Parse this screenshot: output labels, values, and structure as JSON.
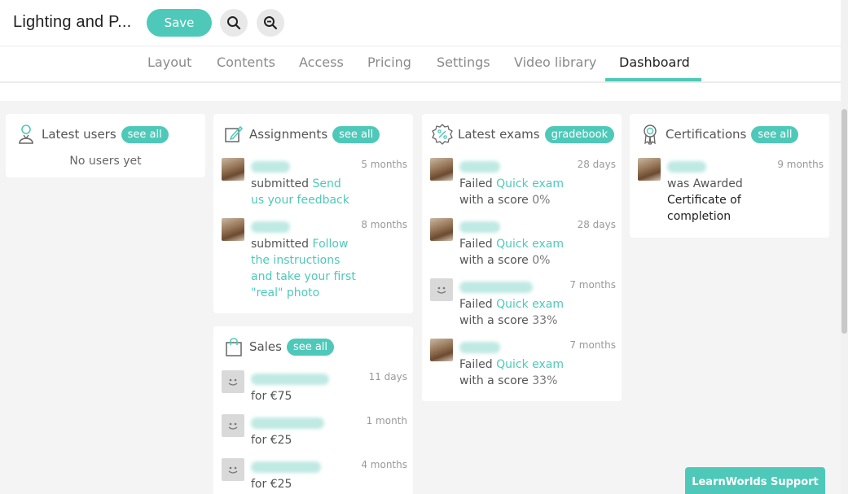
{
  "header": {
    "title": "Lighting and P...",
    "save_label": "Save"
  },
  "tabs": [
    {
      "label": "Layout"
    },
    {
      "label": "Contents"
    },
    {
      "label": "Access"
    },
    {
      "label": "Pricing"
    },
    {
      "label": "Settings"
    },
    {
      "label": "Video library"
    },
    {
      "label": "Dashboard",
      "active": true
    }
  ],
  "cards": {
    "users": {
      "title": "Latest users",
      "action": "see all",
      "empty": "No users yet"
    },
    "assignments": {
      "title": "Assignments",
      "action": "see all",
      "items": [
        {
          "time": "5 months",
          "verb": "submitted",
          "link": "Send us your feedback"
        },
        {
          "time": "8 months",
          "verb": "submitted",
          "link": "Follow the instructions and take your first \"real\" photo"
        }
      ]
    },
    "exams": {
      "title": "Latest exams",
      "action": "gradebook",
      "items": [
        {
          "time": "28 days",
          "verb": "Failed",
          "link": "Quick exam",
          "score_text": "with a score",
          "score": "0%"
        },
        {
          "time": "28 days",
          "verb": "Failed",
          "link": "Quick exam",
          "score_text": "with a score",
          "score": "0%"
        },
        {
          "time": "7 months",
          "verb": "Failed",
          "link": "Quick exam",
          "score_text": "with a score",
          "score": "33%"
        },
        {
          "time": "7 months",
          "verb": "Failed",
          "link": "Quick exam",
          "score_text": "with a score",
          "score": "33%"
        }
      ]
    },
    "certifications": {
      "title": "Certifications",
      "action": "see all",
      "items": [
        {
          "time": "9 months",
          "verb": "was Awarded",
          "cert": "Certificate of completion"
        }
      ]
    },
    "sales": {
      "title": "Sales",
      "action": "see all",
      "items": [
        {
          "time": "11 days",
          "amount": "for €75"
        },
        {
          "time": "1 month",
          "amount": "for €25"
        },
        {
          "time": "4 months",
          "amount": "for €25"
        }
      ]
    }
  },
  "support_label": "LearnWorlds Support",
  "colors": {
    "accent": "#4ec9b9",
    "background": "#f4f4f4"
  }
}
